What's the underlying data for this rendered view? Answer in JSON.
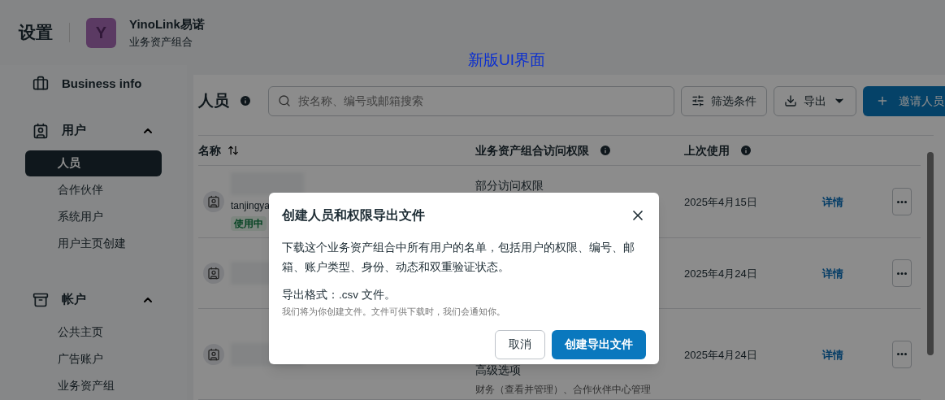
{
  "header": {
    "title": "设置",
    "brand": {
      "initial": "Y",
      "name": "YinoLink易诺",
      "subtitle": "业务资产组合"
    }
  },
  "annotation": "新版UI界面",
  "sidebar": [
    {
      "kind": "link",
      "label": "Business info"
    },
    {
      "kind": "section",
      "label": "用户",
      "expanded": true,
      "children": [
        {
          "label": "人员",
          "selected": true
        },
        {
          "label": "合作伙伴",
          "selected": false
        },
        {
          "label": "系统用户",
          "selected": false
        },
        {
          "label": "用户主页创建",
          "selected": false
        }
      ]
    },
    {
      "kind": "section",
      "label": "帐户",
      "expanded": true,
      "children": [
        {
          "label": "公共主页",
          "selected": false
        },
        {
          "label": "广告账户",
          "selected": false
        },
        {
          "label": "业务资产组",
          "selected": false
        }
      ]
    }
  ],
  "people": {
    "title": "人员",
    "search": {
      "placeholder": "按名称、编号或邮箱搜索"
    },
    "filter_button": "筛选条件",
    "export_button": "导出",
    "invite_button": "邀请人员",
    "columns": [
      {
        "label": "名称",
        "sortable": true,
        "info": false
      },
      {
        "label": "业务资产组合访问权限",
        "sortable": false,
        "info": true
      },
      {
        "label": "上次使用",
        "sortable": false,
        "info": true
      }
    ],
    "rows": [
      {
        "name": "tanjingya",
        "status": "使用中",
        "access": "部分访问权限",
        "last_used": "2025年4月15日",
        "details": "详情"
      },
      {
        "last_used": "2025年4月24日",
        "details": "详情"
      },
      {
        "access": "高级选项",
        "access_detail": "财务（查看并管理）、合作伙伴中心管理",
        "last_used": "2025年4月24日",
        "details": "详情"
      }
    ]
  },
  "dialog": {
    "title": "创建人员和权限导出文件",
    "body": "下载这个业务资产组合中所有用户的名单，包括用户的权限、编号、邮箱、账户类型、身份、动态和双重验证状态。",
    "format": "导出格式：.csv 文件。",
    "note": "我们将为你创建文件。文件可供下载时，我们会通知你。",
    "cancel": "取消",
    "confirm": "创建导出文件"
  }
}
